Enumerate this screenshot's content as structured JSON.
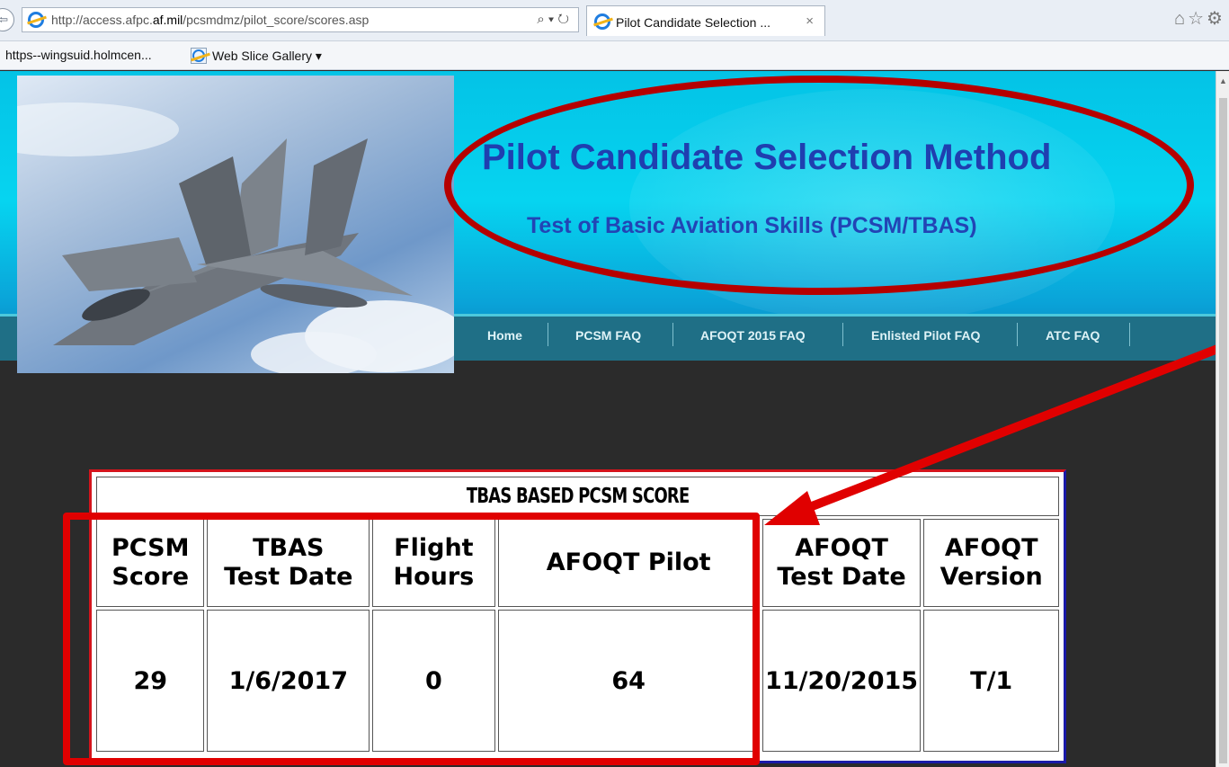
{
  "browser": {
    "url_prefix": "http://access.afpc.",
    "url_domain": "af.mil",
    "url_suffix": "/pcsmdmz/pilot_score/scores.asp",
    "url_actions": "⌕ ▾ ↻",
    "tab_title": "Pilot Candidate Selection ...",
    "tab_close": "×",
    "right_icons": "⌂☆⚙",
    "back_glyph": "⇦",
    "favorites": [
      "https--wingsuid.holmcen...",
      "Web Slice Gallery ▾"
    ]
  },
  "banner": {
    "title": "Pilot Candidate Selection Method",
    "subtitle": "Test of Basic Aviation Skills (PCSM/TBAS)"
  },
  "nav": {
    "items": [
      "Home",
      "PCSM FAQ",
      "AFOQT 2015 FAQ",
      "Enlisted Pilot FAQ",
      "ATC FAQ"
    ]
  },
  "score_table": {
    "caption": "TBAS BASED PCSM SCORE",
    "headers": [
      [
        "PCSM",
        "Score"
      ],
      [
        "TBAS",
        "Test Date"
      ],
      [
        "Flight",
        "Hours"
      ],
      [
        "AFOQT Pilot"
      ],
      [
        "AFOQT",
        "Test Date"
      ],
      [
        "AFOQT",
        "Version"
      ]
    ],
    "values": [
      "29",
      "1/6/2017",
      "0",
      "64",
      "11/20/2015",
      "T/1"
    ]
  },
  "colors": {
    "annotation_red": "#e00000",
    "title_blue": "#1f3fb0",
    "banner_cyan": "#06d4f0",
    "nav_teal": "#1f6f86"
  }
}
